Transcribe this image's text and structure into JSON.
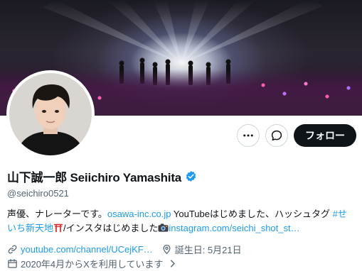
{
  "profile": {
    "display_name": "山下誠一郎 Seiichiro Yamashita",
    "handle": "@seichiro0521",
    "bio": {
      "part1": "声優、ナレーターです。",
      "link1": "osawa-inc.co.jp",
      "part2": " YouTubeはじめました、ハッシュタグ ",
      "hashtag_line1": "#せ",
      "hashtag_line2": "いち新天地",
      "part3": "/インスタはじめました",
      "link2": "instagram.com/seichi_shot_st…"
    },
    "website": "youtube.com/channel/UCejKF…",
    "birthday": "誕生日: 5月21日",
    "joined": "2020年4月からXを利用しています"
  },
  "actions": {
    "more_label": "More",
    "message_label": "Message",
    "follow_label": "フォロー"
  },
  "colors": {
    "accent": "#1d9bf0",
    "text": "#0f1419",
    "secondary": "#536471",
    "follow_bg": "#0f1419"
  },
  "icons": {
    "more": "more-icon",
    "message": "message-icon",
    "verified": "verified-badge-icon",
    "link": "link-icon",
    "location_pin": "location-pin-icon",
    "calendar": "calendar-icon",
    "chevron": "chevron-right-icon",
    "torii": "torii-emoji",
    "camera": "camera-emoji"
  }
}
